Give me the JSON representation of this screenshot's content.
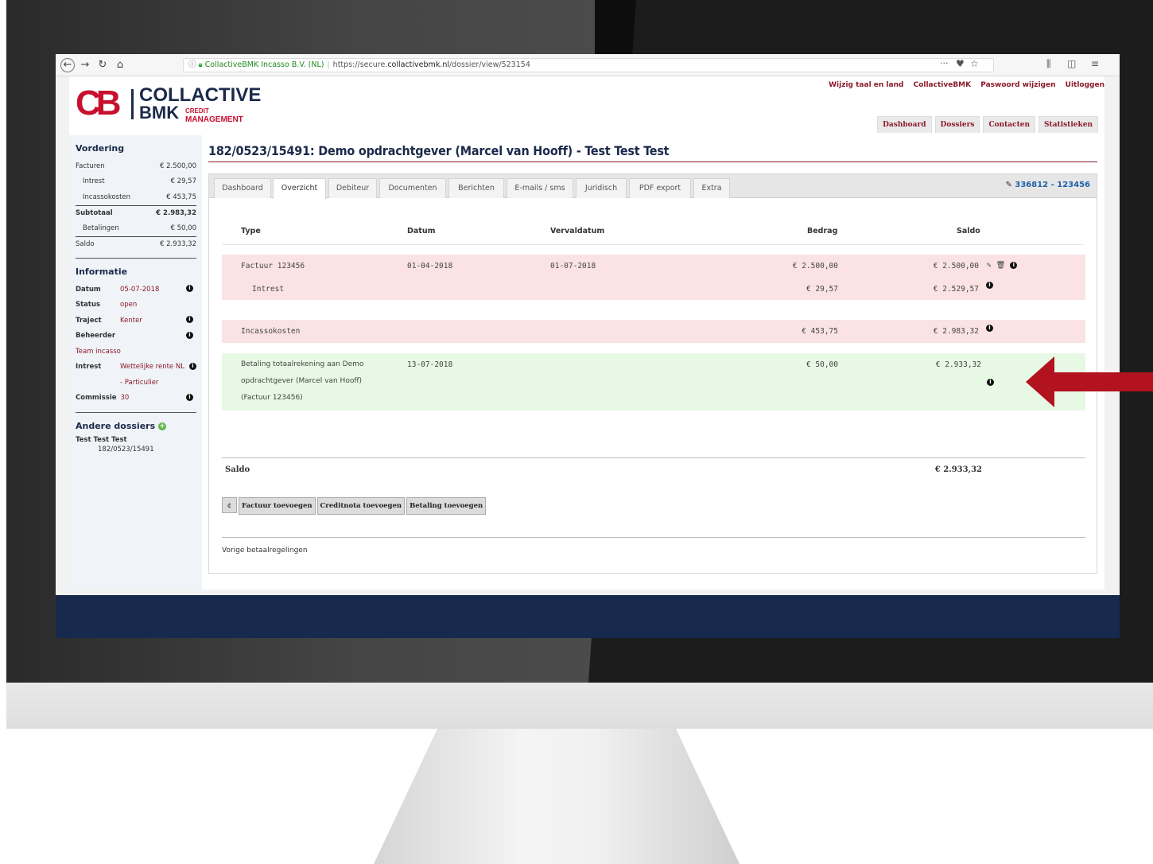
{
  "browser": {
    "site_name": "CollactiveBMK Incasso B.V. (NL)",
    "url_prefix": "https://secure.",
    "url_domain": "collactivebmk.nl",
    "url_path": "/dossier/view/523154",
    "more_label": "···",
    "icons": [
      "back-icon",
      "forward-icon",
      "reload-icon",
      "home-icon",
      "info-icon",
      "lock-icon",
      "pocket-icon",
      "star-icon",
      "library-icon",
      "sidebar-icon",
      "menu-icon"
    ]
  },
  "logo": {
    "cb": "CB",
    "line1": "COLLACTIVE",
    "line2": "BMK",
    "line3": "CREDIT",
    "line4": "MANAGEMENT"
  },
  "top_links": [
    "Wijzig taal en land",
    "CollactiveBMK",
    "Paswoord wijzigen",
    "Uitloggen"
  ],
  "main_tabs": [
    "Dashboard",
    "Dossiers",
    "Contacten",
    "Statistieken"
  ],
  "sidebar": {
    "vordering_title": "Vordering",
    "vordering": [
      {
        "label": "Facturen",
        "value": "€ 2.500,00"
      },
      {
        "label": "Intrest",
        "value": "€ 29,57"
      },
      {
        "label": "Incassokosten",
        "value": "€ 453,75"
      },
      {
        "label": "Subtotaal",
        "value": "€ 2.983,32"
      },
      {
        "label": "Betalingen",
        "value": "€ 50,00"
      },
      {
        "label": "Saldo",
        "value": "€ 2.933,32"
      }
    ],
    "informatie_title": "Informatie",
    "info": [
      {
        "label": "Datum",
        "value": "05-07-2018"
      },
      {
        "label": "Status",
        "value": "open"
      },
      {
        "label": "Traject",
        "value": "Kenter"
      },
      {
        "label": "Beheerder",
        "value": "Team incasso"
      },
      {
        "label": "Intrest",
        "value": "Wettelijke rente NL",
        "value2": "- Particulier"
      },
      {
        "label": "Commissie",
        "value": "30"
      }
    ],
    "andere_title": "Andere dossiers",
    "andere_name": "Test Test Test",
    "andere_num": "182/0523/15491"
  },
  "dossier_title": "182/0523/15491: Demo opdrachtgever (Marcel van Hooff) - Test Test Test",
  "tabs": [
    "Dashboard",
    "Overzicht",
    "Debiteur",
    "Documenten",
    "Berichten",
    "E-mails / sms",
    "Juridisch",
    "PDF export",
    "Extra"
  ],
  "active_tab": "Overzicht",
  "dossier_num": "336812 - 123456",
  "table": {
    "headers": {
      "type": "Type",
      "datum": "Datum",
      "vervaldatum": "Vervaldatum",
      "bedrag": "Bedrag",
      "saldo": "Saldo"
    },
    "rows": [
      {
        "type": "Factuur 123456",
        "datum": "01-04-2018",
        "vervaldatum": "01-07-2018",
        "bedrag": "€ 2.500,00",
        "saldo": "€ 2.500,00",
        "sub_type": "Intrest",
        "sub_bedrag": "€ 29,57",
        "sub_saldo": "€ 2.529,57"
      },
      {
        "type": "Incassokosten",
        "bedrag": "€ 453,75",
        "saldo": "€ 2.983,32"
      },
      {
        "type_l1": "Betaling totaalrekening aan Demo",
        "type_l2": "opdrachtgever (Marcel van Hooff)",
        "type_l3": "(Factuur 123456)",
        "datum": "13-07-2018",
        "bedrag": "€ 50,00",
        "saldo": "€ 2.933,32"
      }
    ]
  },
  "summary": {
    "label": "Saldo",
    "value": "€ 2.933,32"
  },
  "buttons": {
    "refresh": "¢",
    "factuur": "Factuur toevoegen",
    "creditnota": "Creditnota toevoegen",
    "betaling": "Betaling toevoegen"
  },
  "vorige": "Vorige betaalregelingen",
  "colors": {
    "brand_red": "#c8102e",
    "navy": "#1b2a4a",
    "link_red": "#8b1a2b",
    "pink_row": "#fbe3e3",
    "green_row": "#e7f9e4",
    "arrow": "#b3121f"
  }
}
